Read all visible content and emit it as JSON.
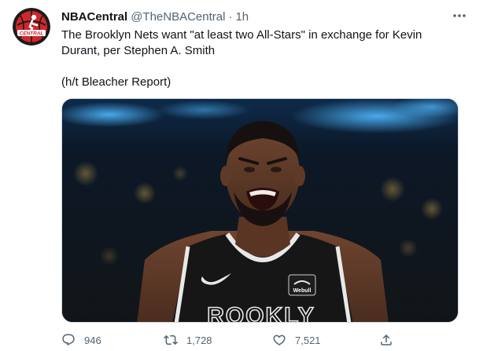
{
  "tweet": {
    "author_name": "NBACentral",
    "handle": "@TheNBACentral",
    "separator": "·",
    "time": "1h",
    "avatar_text": "CENTRAL",
    "text_line1": "The Brooklyn Nets want \"at least two All-Stars\" in exchange for Kevin Durant, per Stephen A. Smith",
    "text_line2": "(h/t Bleacher Report)",
    "media": {
      "jersey_text": "ROOKLY",
      "patch_text": "Webull"
    },
    "actions": {
      "replies": "946",
      "retweets": "1,728",
      "likes": "7,521"
    }
  },
  "colors": {
    "avatar_red": "#d1262c",
    "text_primary": "#0f1419",
    "text_secondary": "#536471",
    "border": "#cfd9de"
  },
  "icons": {
    "more": "more-horizontal-icon",
    "reply": "reply-icon",
    "retweet": "retweet-icon",
    "like": "heart-icon",
    "share": "share-icon"
  }
}
